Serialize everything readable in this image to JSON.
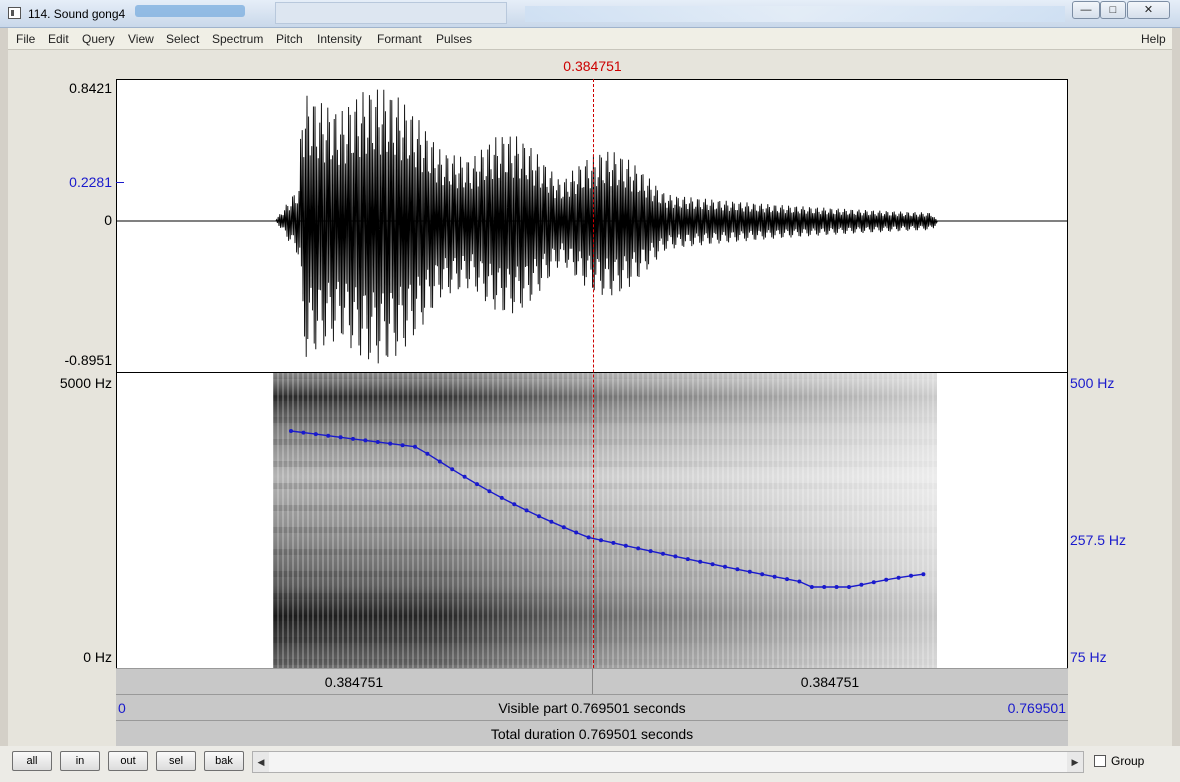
{
  "window": {
    "title": "114. Sound gong4",
    "controls": {
      "minimize": "—",
      "maximize": "□",
      "close": "✕"
    }
  },
  "menu": {
    "items": [
      "File",
      "Edit",
      "Query",
      "View",
      "Select",
      "Spectrum",
      "Pitch",
      "Intensity",
      "Formant",
      "Pulses"
    ],
    "help": "Help"
  },
  "cursor": {
    "time": "0.384751"
  },
  "waveform": {
    "y_max": "0.8421",
    "y_cursor": "0.2281",
    "y_zero": "0",
    "y_min": "-0.8951"
  },
  "spectrogram": {
    "freq_top": "5000 Hz",
    "freq_bottom": "0 Hz"
  },
  "pitch": {
    "top": "500 Hz",
    "mid": "257.5 Hz",
    "bottom": "75 Hz"
  },
  "time_bars": {
    "left_segment": "0.384751",
    "right_segment": "0.384751",
    "visible_start": "0",
    "visible_label": "Visible part 0.769501 seconds",
    "visible_end": "0.769501",
    "total_label": "Total duration 0.769501 seconds"
  },
  "buttons": {
    "all": "all",
    "in": "in",
    "out": "out",
    "sel": "sel",
    "bak": "bak"
  },
  "scroll": {
    "left": "◀",
    "right": "▶"
  },
  "group_label": "Group",
  "colors": {
    "cursor": "#cc0000",
    "pitch": "#1a1acc",
    "axis_blue": "#1a1acc"
  }
}
